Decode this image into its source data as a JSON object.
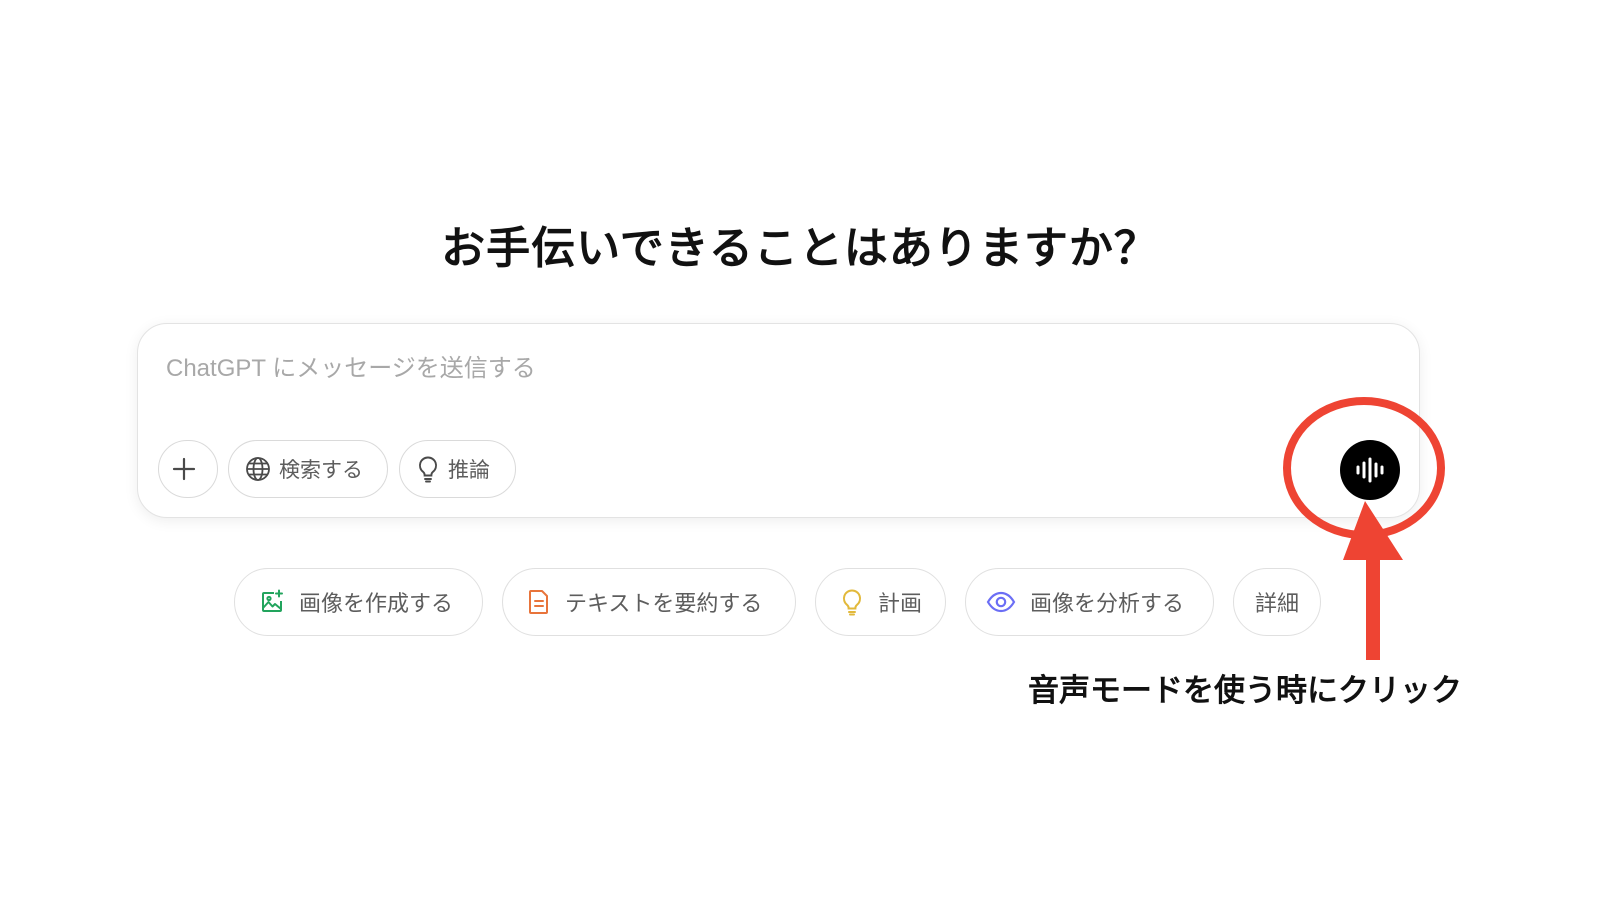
{
  "colors": {
    "annotation": "#ee4433",
    "voice_button": "#000000",
    "image_icon": "#22a45d",
    "doc_icon": "#e8743b",
    "bulb_icon": "#e2b93b",
    "eye_icon": "#6b6ef5"
  },
  "main": {
    "headline": "お手伝いできることはありますか？"
  },
  "composer": {
    "placeholder": "ChatGPT にメッセージを送信する",
    "value": "",
    "toolbar": {
      "plus_icon": "plus-icon",
      "search_label": "検索する",
      "search_icon": "globe-icon",
      "reason_label": "推論",
      "reason_icon": "lightbulb-icon",
      "voice_icon": "voice-waveform-icon"
    }
  },
  "suggestions": [
    {
      "label": "画像を作成する",
      "icon": "image-sparkle-icon"
    },
    {
      "label": "テキストを要約する",
      "icon": "document-icon"
    },
    {
      "label": "計画",
      "icon": "lightbulb-icon"
    },
    {
      "label": "画像を分析する",
      "icon": "eye-icon"
    },
    {
      "label": "詳細",
      "icon": ""
    }
  ],
  "annotation": {
    "text": "音声モードを使う時にクリック"
  }
}
